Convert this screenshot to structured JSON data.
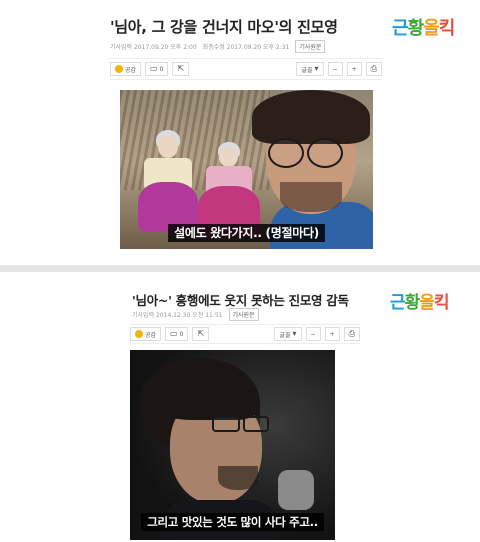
{
  "articles": [
    {
      "title": "'님아, 그 강을 건너지 마오'의 진모영",
      "meta": {
        "published": "기사입력 2017.09.20 오후 2:00",
        "modified": "최종수정 2017.09.20 오후 2:31",
        "original_label": "기사원문"
      },
      "logo": {
        "p1": "근",
        "p2": "황",
        "p3": "올",
        "p4": "킥"
      },
      "toolbar": {
        "like_label": "공감",
        "comment_count": "0",
        "font_label": "글꼴",
        "minus": "−",
        "plus": "+"
      },
      "caption": "설에도 왔다가지.. (명절마다)"
    },
    {
      "title": "'님아~' 흥행에도 웃지 못하는 진모영 감독",
      "meta": {
        "published": "기사입력 2014.12.30 오전 11:51",
        "original_label": "기사원문"
      },
      "logo": {
        "p1": "근",
        "p2": "황",
        "p3": "올",
        "p4": "킥"
      },
      "toolbar": {
        "like_label": "공감",
        "comment_count": "0",
        "font_label": "글꼴",
        "minus": "−",
        "plus": "+"
      },
      "caption": "그리고 맛있는 것도 많이 사다 주고.."
    }
  ],
  "colors": {
    "logo_blue": "#1f9bd6",
    "logo_green": "#3aa935",
    "logo_orange": "#f39c12",
    "logo_red": "#e74c3c",
    "divider": "#e4e4e4"
  },
  "icons": [
    "smile-icon",
    "comment-icon",
    "share-icon",
    "print-icon",
    "chevron-down-icon"
  ]
}
